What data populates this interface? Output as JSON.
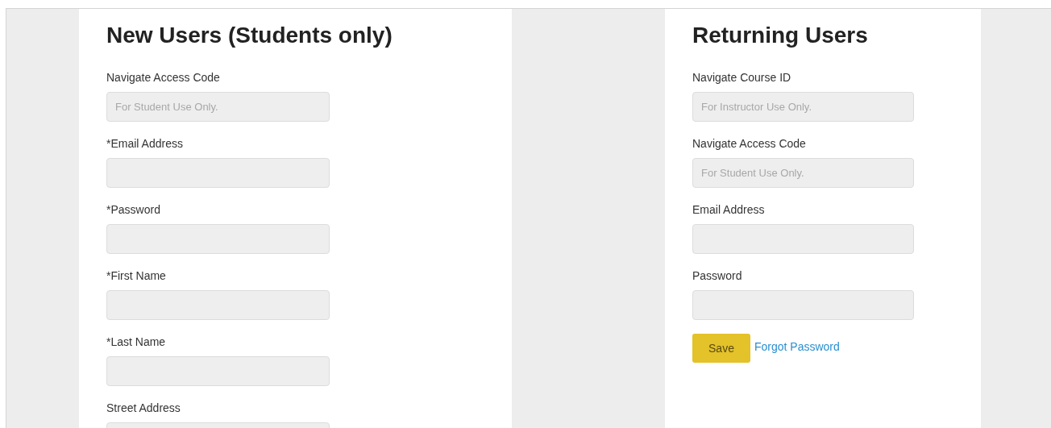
{
  "panels": [
    {
      "title": "New Users (Students only)",
      "fields": [
        {
          "label": "Navigate Access Code",
          "placeholder": "For Student Use Only."
        },
        {
          "label": "*Email Address"
        },
        {
          "label": "*Password"
        },
        {
          "label": "*First Name"
        },
        {
          "label": "*Last Name"
        },
        {
          "label": "Street Address"
        }
      ]
    },
    {
      "title": "Returning Users",
      "fields": [
        {
          "label": "Navigate Course ID",
          "placeholder": "For Instructor Use Only."
        },
        {
          "label": "Navigate Access Code",
          "placeholder": "For Student Use Only."
        },
        {
          "label": "Email Address"
        },
        {
          "label": "Password"
        }
      ],
      "actions": [
        {
          "kind": "button",
          "label": "Save"
        },
        {
          "kind": "link",
          "label": "Forgot Password"
        }
      ]
    }
  ]
}
